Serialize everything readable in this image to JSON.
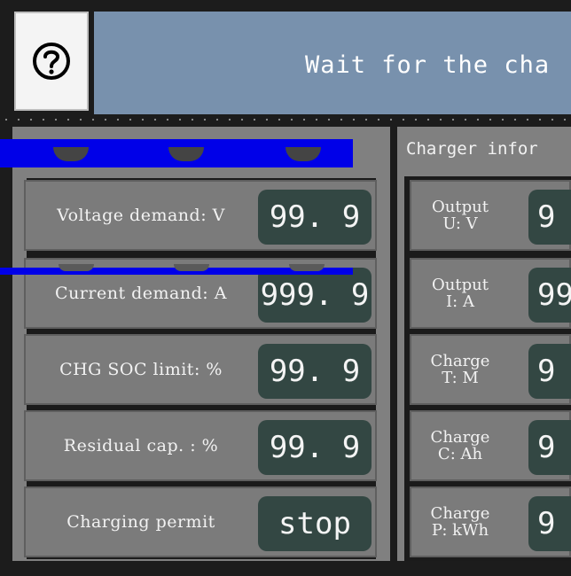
{
  "header": {
    "help_icon": "question-circle-icon",
    "title": "Wait for the cha"
  },
  "demand": {
    "rows": [
      {
        "label": "Voltage demand: V",
        "value": "99. 9"
      },
      {
        "label": "Current demand: A",
        "value": "999. 9"
      },
      {
        "label": "CHG SOC limit: %",
        "value": "99. 9"
      },
      {
        "label": "Residual cap. : %",
        "value": "99. 9"
      },
      {
        "label": "Charging permit",
        "value": "stop"
      }
    ]
  },
  "charger": {
    "header": "Charger infor",
    "rows": [
      {
        "label_line1": "Output",
        "label_line2": "U: V",
        "value": "9"
      },
      {
        "label_line1": "Output",
        "label_line2": "I: A",
        "value": "99"
      },
      {
        "label_line1": "Charge",
        "label_line2": "T: M",
        "value": "9"
      },
      {
        "label_line1": "Charge",
        "label_line2": "C: Ah",
        "value": "9"
      },
      {
        "label_line1": "Charge",
        "label_line2": "P: kWh",
        "value": "9"
      }
    ]
  },
  "colors": {
    "title_bar": "#7891ad",
    "panel": "#808080",
    "value_box": "#334743",
    "overlay_stripe": "#0000e8"
  }
}
